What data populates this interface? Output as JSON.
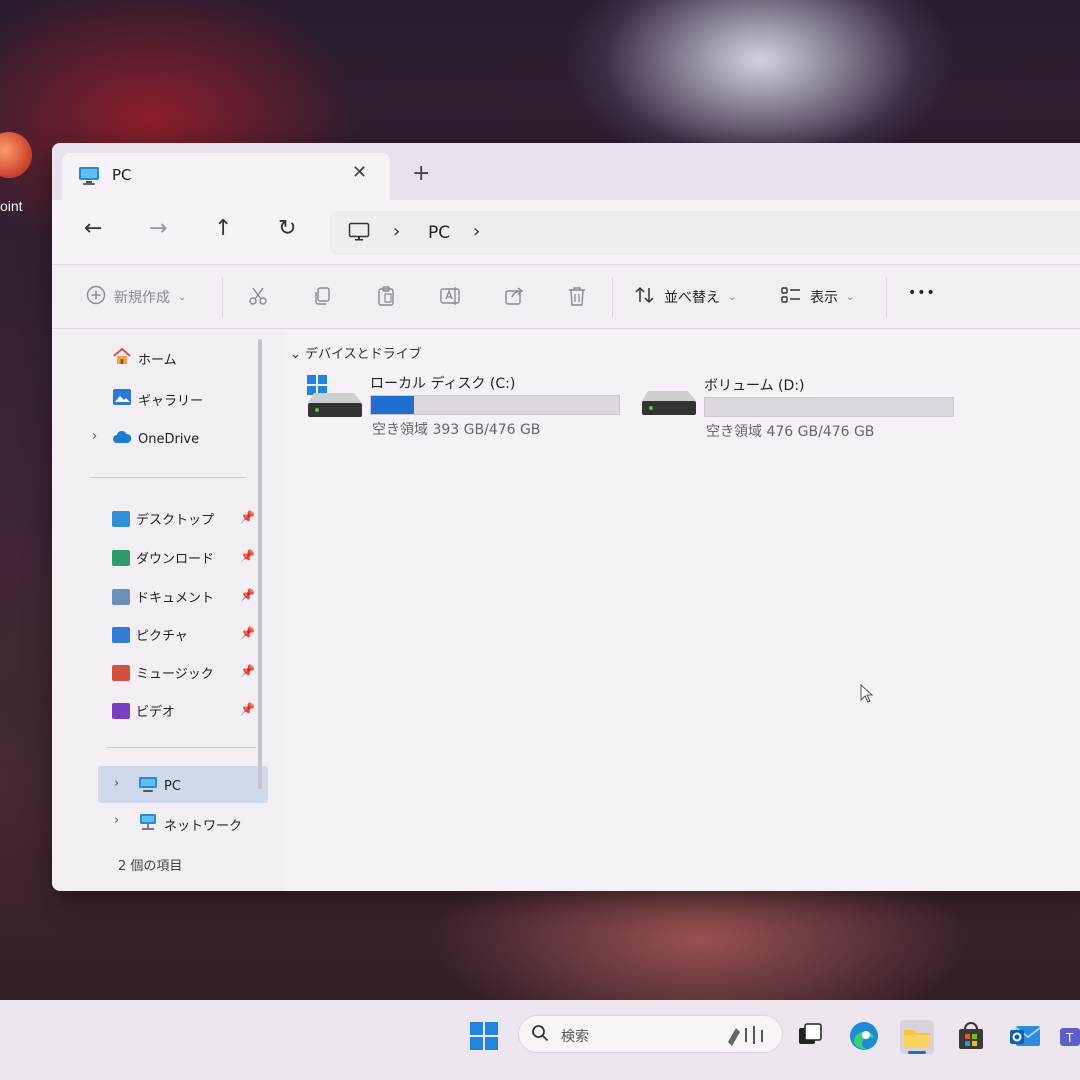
{
  "desktop": {
    "icon_label": "oint"
  },
  "window": {
    "tab_title": "PC",
    "tab_close": "✕",
    "new_tab": "+"
  },
  "nav": {
    "back": "←",
    "forward": "→",
    "up": "↑",
    "refresh": "↻",
    "breadcrumb": "PC",
    "chevron": "›"
  },
  "toolbar": {
    "new_label": "新規作成",
    "sort_label": "並べ替え",
    "view_label": "表示",
    "more": "•••",
    "caret": "⌄"
  },
  "sidebar": {
    "home": "ホーム",
    "gallery": "ギャラリー",
    "onedrive": "OneDrive",
    "quick": [
      "デスクトップ",
      "ダウンロード",
      "ドキュメント",
      "ピクチャ",
      "ミュージック",
      "ビデオ"
    ],
    "pc": "PC",
    "network": "ネットワーク",
    "expander": "›",
    "pin": "📌"
  },
  "content": {
    "group_header": "デバイスとドライブ",
    "group_chevron": "⌄",
    "drives": [
      {
        "name": "ローカル ディスク (C:)",
        "space": "空き領域 393 GB/476 GB",
        "used_fraction": 0.174
      },
      {
        "name": "ボリューム (D:)",
        "space": "空き領域 476 GB/476 GB",
        "used_fraction": 0.0
      }
    ]
  },
  "statusbar": {
    "text": "2 個の項目"
  },
  "taskbar": {
    "search_placeholder": "検索"
  },
  "colors": {
    "accent": "#1f6fd1",
    "selected": "#cfd9ec",
    "window_bg": "#f3eef4"
  }
}
